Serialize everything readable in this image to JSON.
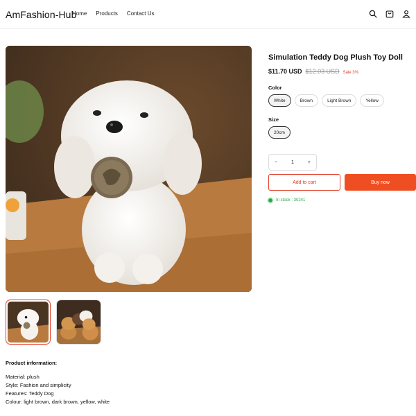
{
  "header": {
    "brand": "AmFashion-Hub",
    "nav": [
      "Home",
      "Products",
      "Contact Us"
    ],
    "icons": [
      "search-icon",
      "cart-icon",
      "user-icon"
    ]
  },
  "product": {
    "title": "Simulation Teddy Dog Plush Toy Doll",
    "price": "$11.70 USD",
    "old_price": "$12.03 USD",
    "sale_label": "Sale 3%",
    "color_label": "Color",
    "colors": [
      "White",
      "Brown",
      "Light Brown",
      "Yellow"
    ],
    "selected_color": "White",
    "size_label": "Size",
    "sizes": [
      "20cm"
    ],
    "selected_size": "20cm",
    "quantity": "1",
    "minus": "−",
    "plus": "+",
    "add_to_cart": "Add to cart",
    "buy_now": "Buy now",
    "stock": "In stock : 30241"
  },
  "gallery": {
    "thumbnail_count": 2,
    "active_index": 0
  },
  "details": {
    "heading": "Product information:",
    "lines": [
      "Material: plush",
      "Style: Fashion and simplicity",
      "Features: Teddy Dog",
      "Colour: light brown, dark brown, yellow, white"
    ]
  },
  "colors": {
    "accent": "#ef4e22",
    "stock_green": "#2ba84a"
  }
}
